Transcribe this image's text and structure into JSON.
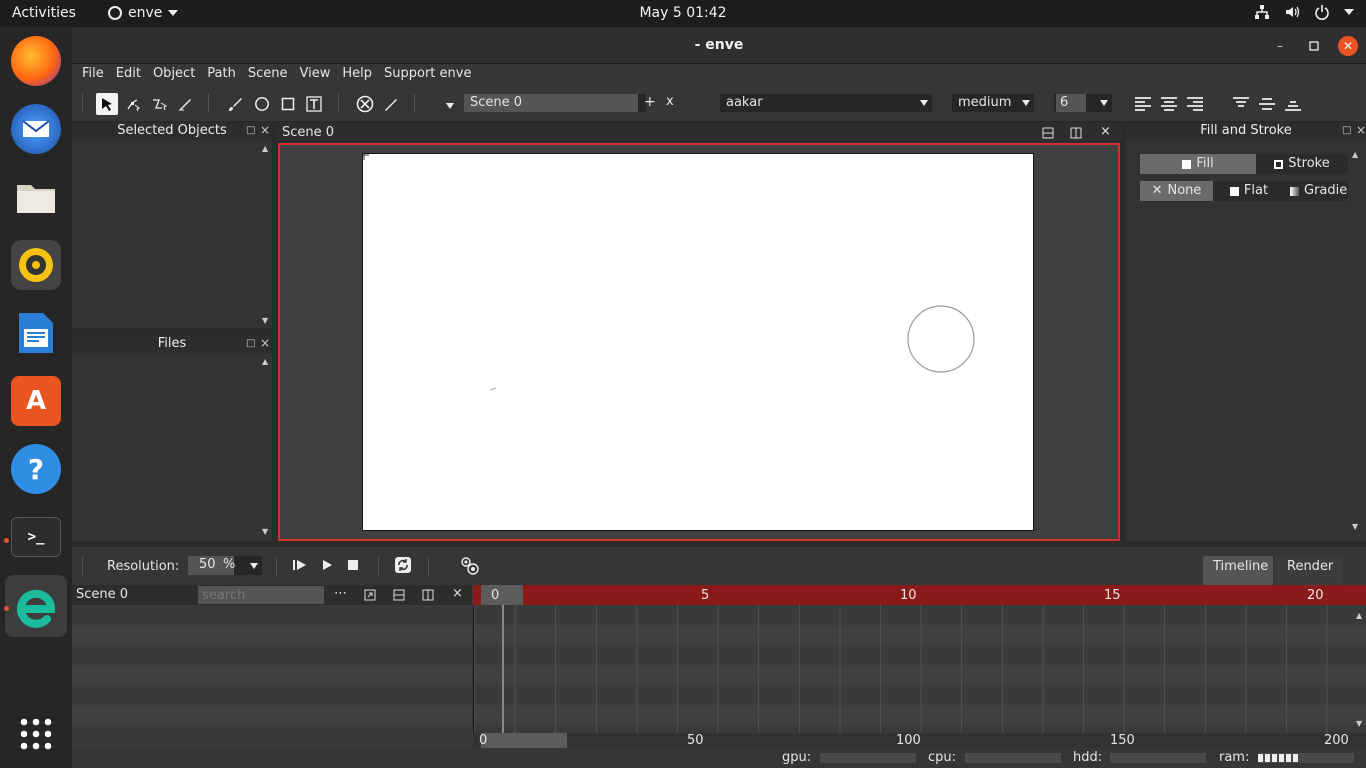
{
  "topbar": {
    "activities": "Activities",
    "app_name": "enve",
    "clock": "May 5  01:42"
  },
  "dock": {
    "items": [
      "Firefox",
      "Thunderbird",
      "Files",
      "Rhythmbox",
      "LibreOffice Writer",
      "Ubuntu Software",
      "Help",
      "Terminal",
      "enve",
      "Show Applications"
    ]
  },
  "window": {
    "title": "- enve"
  },
  "menu": [
    "File",
    "Edit",
    "Object",
    "Path",
    "Scene",
    "View",
    "Help",
    "Support enve"
  ],
  "toolbar": {
    "scene_field": "Scene 0",
    "add_label": "+",
    "remove_label": "x",
    "font_family": "aakar",
    "font_weight": "medium",
    "font_size": "6"
  },
  "panels": {
    "selected_objects": "Selected Objects",
    "files": "Files",
    "scene_tab": "Scene 0",
    "fill_stroke": "Fill and Stroke",
    "fill": "Fill",
    "stroke": "Stroke",
    "none": "None",
    "flat": "Flat",
    "gradient": "Gradier"
  },
  "playbar": {
    "resolution_label": "Resolution:",
    "resolution_value": "50",
    "resolution_unit": "%",
    "timeline_tab": "Timeline",
    "render_tab": "Render"
  },
  "timeline": {
    "scene_name": "Scene 0",
    "search_placeholder": "search",
    "ruler_top": [
      "0",
      "5",
      "10",
      "15",
      "20"
    ],
    "ruler_bottom": [
      "0",
      "50",
      "100",
      "150",
      "200"
    ]
  },
  "status": {
    "gpu": "gpu:",
    "cpu": "cpu:",
    "hdd": "hdd:",
    "ram": "ram:"
  },
  "colors": {
    "accent": "#e95420",
    "canvas_border": "#d32f2f",
    "timeline_ruler": "#8b1a1a"
  }
}
